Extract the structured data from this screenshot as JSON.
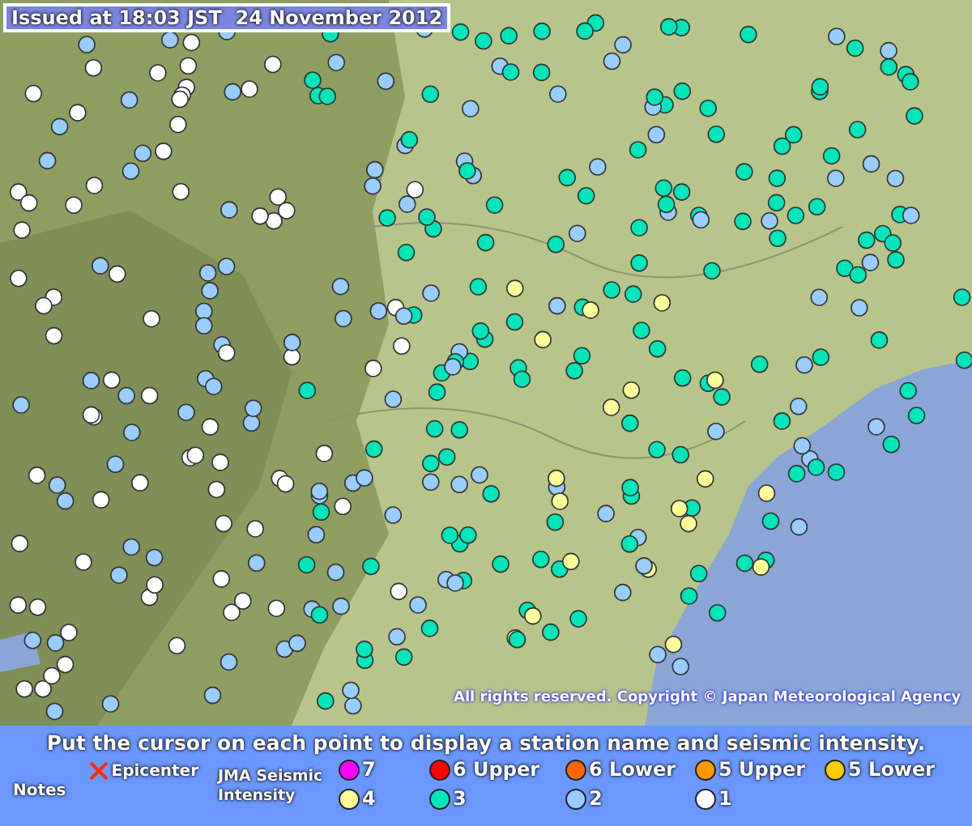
{
  "map": {
    "issued": "Issued at 18:03 JST  24 November 2012",
    "copyright": "All rights reserved. Copyright © Japan Meteorological Agency"
  },
  "legend": {
    "instruction": "Put the cursor on each point to display a station name and seismic intensity.",
    "notes_label": "Notes",
    "epicenter_label": "Epicenter",
    "intensity_label": "JMA Seismic Intensity",
    "intensities": [
      {
        "label": "7",
        "color": "#ff00ff"
      },
      {
        "label": "6 Upper",
        "color": "#ff0000"
      },
      {
        "label": "6 Lower",
        "color": "#ff6600"
      },
      {
        "label": "5 Upper",
        "color": "#ff9900"
      },
      {
        "label": "5 Lower",
        "color": "#ffcc00"
      },
      {
        "label": "4",
        "color": "#ffff99"
      },
      {
        "label": "3",
        "color": "#00e6b8"
      },
      {
        "label": "2",
        "color": "#99ccff"
      },
      {
        "label": "1",
        "color": "#ffffff"
      }
    ]
  }
}
